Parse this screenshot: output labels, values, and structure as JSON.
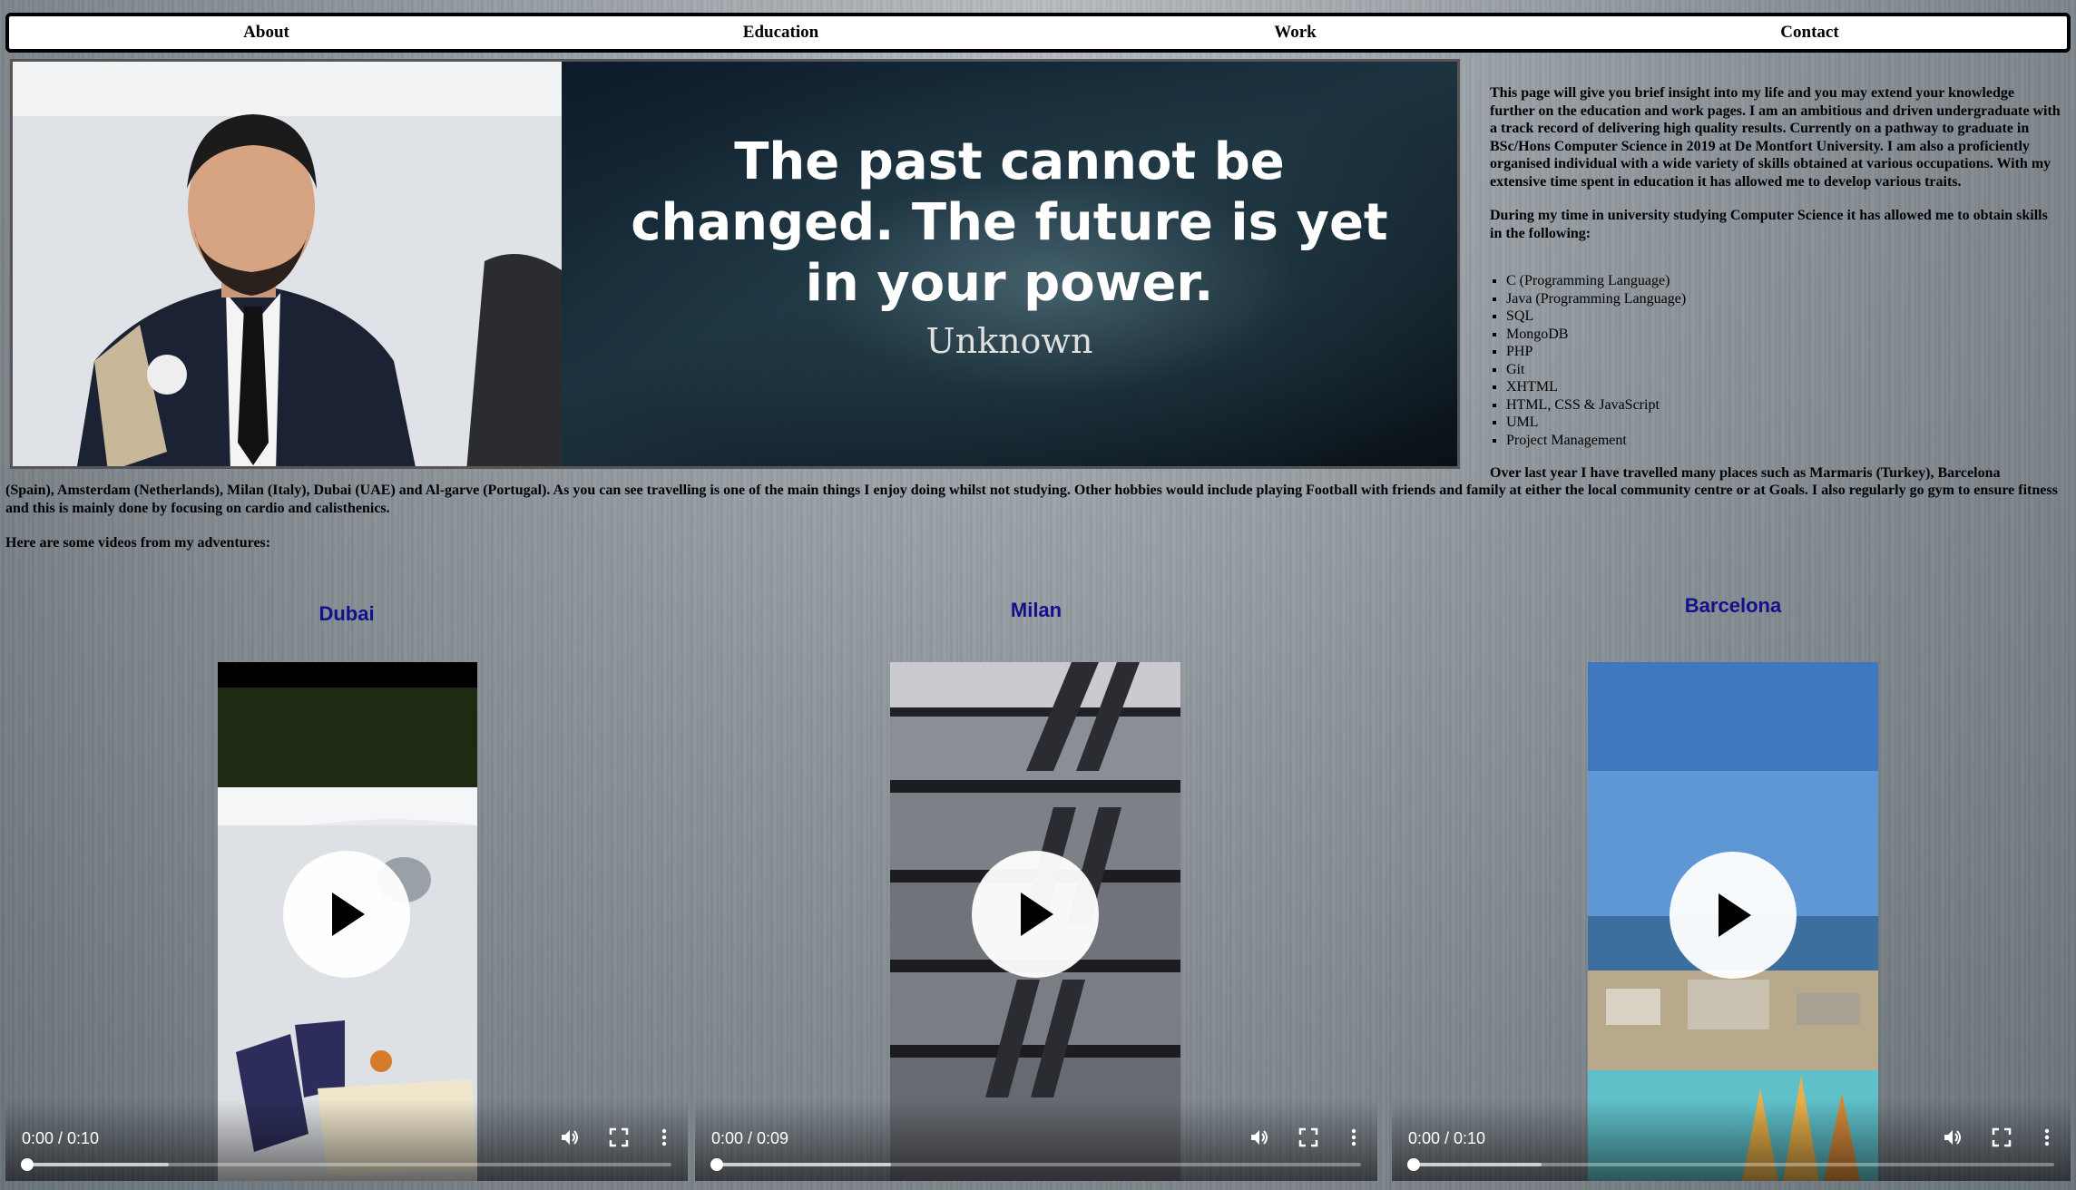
{
  "nav": {
    "items": [
      {
        "label": "About"
      },
      {
        "label": "Education"
      },
      {
        "label": "Work"
      },
      {
        "label": "Contact"
      }
    ]
  },
  "banner": {
    "quote": "The past cannot be changed. The future is yet in your power.",
    "author": "Unknown"
  },
  "intro": {
    "p1": "This page will give you brief insight into my life and you may extend your knowledge further on the education and work pages. I am an ambitious and driven undergraduate with a track record of delivering high quality results. Currently on a pathway to graduate in BSc/Hons Computer Science in 2019 at De Montfort University. I am also a proficiently organised individual with a wide variety of skills obtained at various occupations. With my extensive time spent in education it has allowed me to develop various traits.",
    "p2": "During my time in university studying Computer Science it has allowed me to obtain skills in the following:"
  },
  "skills": [
    "C (Programming Language)",
    "Java (Programming Language)",
    "SQL",
    "MongoDB",
    "PHP",
    "Git",
    "XHTML",
    "HTML, CSS & JavaScript",
    "UML",
    "Project Management"
  ],
  "travel": {
    "line1": "Over last year I have travelled many places such as Marmaris (Turkey), Barcelona",
    "rest": "(Spain), Amsterdam (Netherlands), Milan (Italy), Dubai (UAE) and Al-garve (Portugal). As you can see travelling is one of the main things I enjoy doing whilst not studying. Other hobbies would include playing Football with friends and family at either the local community centre or at Goals. I also regularly go gym to ensure fitness and this is mainly done by focusing on cardio and calisthenics.",
    "videos_intro": "Here are some videos from my adventures:"
  },
  "videos": [
    {
      "title": "Dubai",
      "time": "0:00 / 0:10",
      "progress": 0.0
    },
    {
      "title": "Milan",
      "time": "0:00 / 0:09",
      "progress": 0.0
    },
    {
      "title": "Barcelona",
      "time": "0:00 / 0:10",
      "progress": 0.0
    }
  ],
  "icons": {
    "play": "play-icon",
    "volume": "volume-icon",
    "fullscreen": "fullscreen-icon",
    "more": "more-vertical-icon"
  }
}
